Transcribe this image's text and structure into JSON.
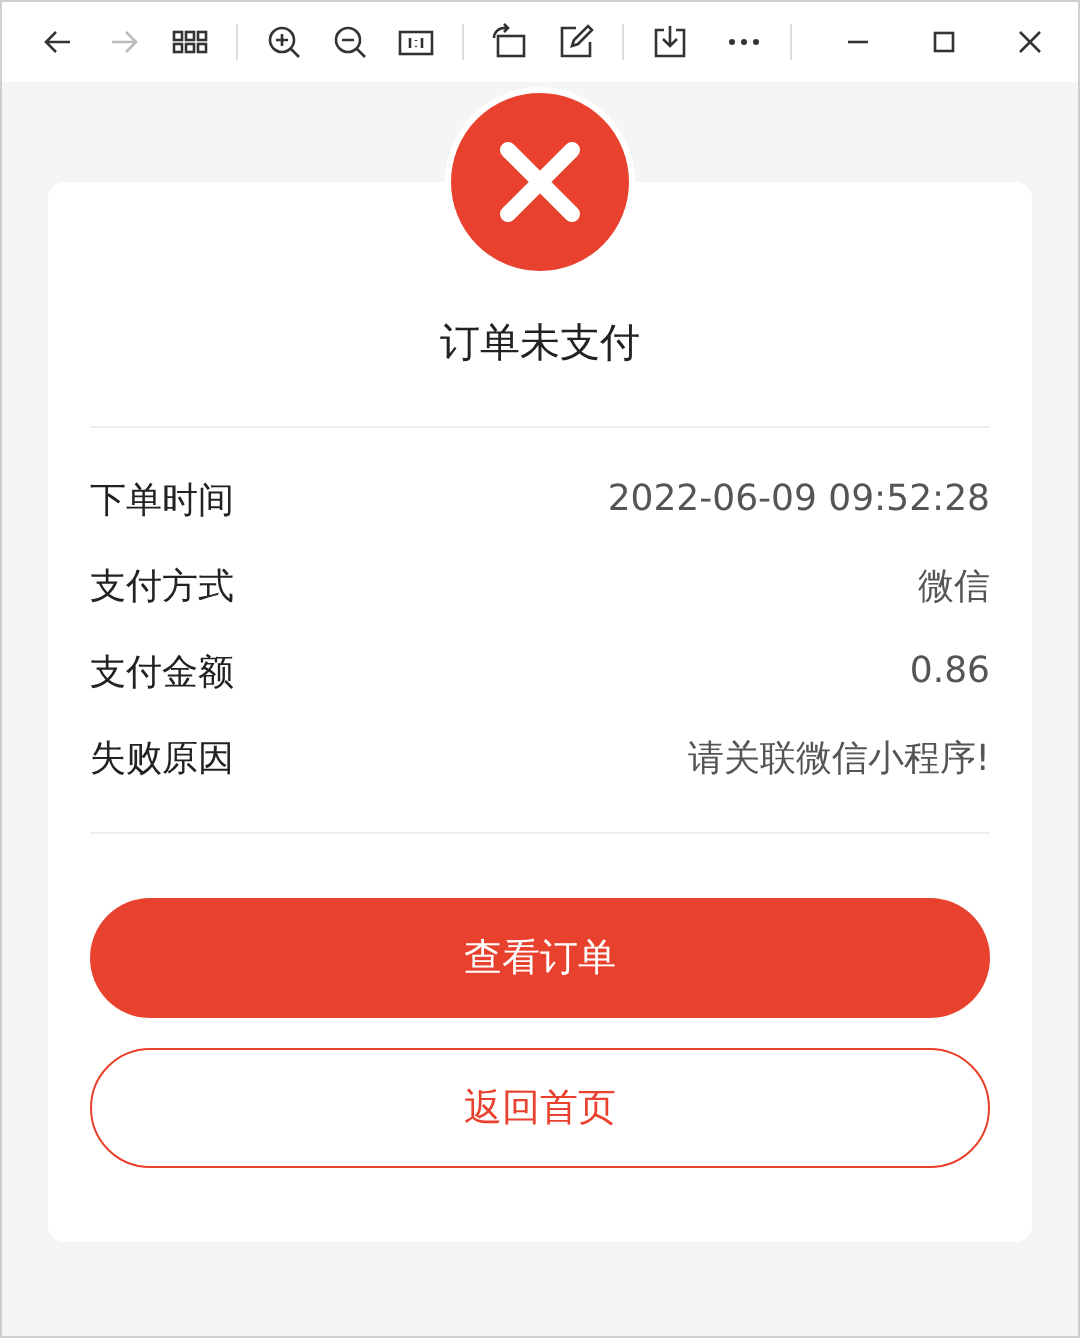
{
  "toolbar": {
    "items": [
      {
        "kind": "back",
        "disabled": false
      },
      {
        "kind": "forward",
        "disabled": true
      },
      {
        "kind": "grid",
        "disabled": false
      },
      {
        "kind": "sep"
      },
      {
        "kind": "zoom-in",
        "disabled": false
      },
      {
        "kind": "zoom-out",
        "disabled": false
      },
      {
        "kind": "actual-size",
        "disabled": false
      },
      {
        "kind": "sep"
      },
      {
        "kind": "rotate",
        "disabled": false
      },
      {
        "kind": "edit",
        "disabled": false
      },
      {
        "kind": "sep"
      },
      {
        "kind": "download",
        "disabled": false
      }
    ],
    "window_controls": [
      {
        "kind": "more"
      },
      {
        "kind": "sep"
      },
      {
        "kind": "minimize"
      },
      {
        "kind": "maximize"
      },
      {
        "kind": "close"
      }
    ]
  },
  "status": {
    "kind": "failed",
    "title": "订单未支付"
  },
  "details": [
    {
      "label": "下单时间",
      "value": "2022-06-09 09:52:28"
    },
    {
      "label": "支付方式",
      "value": "微信"
    },
    {
      "label": "支付金额",
      "value": "0.86"
    },
    {
      "label": "失败原因",
      "value": "请关联微信小程序!"
    }
  ],
  "buttons": [
    {
      "label": "查看订单",
      "kind": "primary"
    },
    {
      "label": "返回首页",
      "kind": "outline"
    }
  ]
}
